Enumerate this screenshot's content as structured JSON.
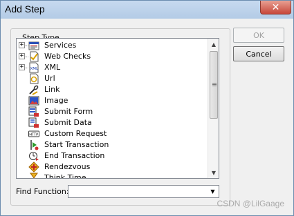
{
  "window": {
    "title": "Add Step",
    "close_symbol": "✕"
  },
  "group": {
    "legend": "Step Type"
  },
  "steps": [
    {
      "label": "Services",
      "expandable": true,
      "icon": "services-icon"
    },
    {
      "label": "Web Checks",
      "expandable": true,
      "icon": "web-checks-icon"
    },
    {
      "label": "XML",
      "expandable": true,
      "icon": "xml-icon"
    },
    {
      "label": "Url",
      "expandable": false,
      "icon": "url-icon"
    },
    {
      "label": "Link",
      "expandable": false,
      "icon": "link-icon"
    },
    {
      "label": "Image",
      "expandable": false,
      "icon": "image-icon"
    },
    {
      "label": "Submit Form",
      "expandable": false,
      "icon": "submit-form-icon"
    },
    {
      "label": "Submit Data",
      "expandable": false,
      "icon": "submit-data-icon"
    },
    {
      "label": "Custom Request",
      "expandable": false,
      "icon": "custom-request-icon"
    },
    {
      "label": "Start Transaction",
      "expandable": false,
      "icon": "start-transaction-icon"
    },
    {
      "label": "End Transaction",
      "expandable": false,
      "icon": "end-transaction-icon"
    },
    {
      "label": "Rendezvous",
      "expandable": false,
      "icon": "rendezvous-icon"
    },
    {
      "label": "Think Time",
      "expandable": false,
      "icon": "think-time-icon"
    }
  ],
  "icon_texts": {
    "xml": "XML",
    "http": "HTTP"
  },
  "find": {
    "label": "Find Function:",
    "value": ""
  },
  "buttons": {
    "ok": "OK",
    "cancel": "Cancel"
  },
  "watermark": "CSDN @LilGaage"
}
